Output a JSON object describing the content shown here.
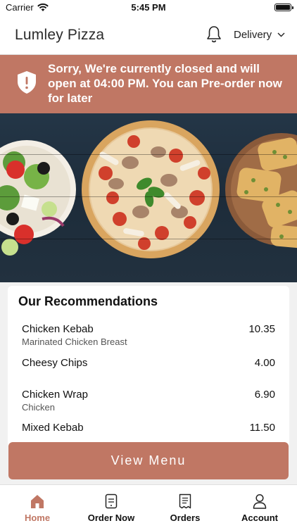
{
  "status_bar": {
    "carrier": "Carrier",
    "time": "5:45 PM"
  },
  "header": {
    "title": "Lumley Pizza",
    "mode_label": "Delivery"
  },
  "banner": {
    "message": "Sorry, We're currently closed and will open at 04:00 PM. You can Pre-order now for later"
  },
  "recommendations": {
    "heading": "Our Recommendations",
    "items": [
      {
        "name": "Chicken Kebab",
        "description": "Marinated Chicken Breast",
        "price": "10.35"
      },
      {
        "name": "Cheesy Chips",
        "description": "",
        "price": "4.00"
      },
      {
        "name": "Chicken Wrap",
        "description": "Chicken",
        "price": "6.90"
      },
      {
        "name": "Mixed Kebab",
        "description": "",
        "price": "11.50"
      }
    ]
  },
  "view_menu_label": "View Menu",
  "tabs": [
    {
      "label": "Home",
      "icon": "home-icon",
      "active": true
    },
    {
      "label": "Order Now",
      "icon": "order-icon",
      "active": false
    },
    {
      "label": "Orders",
      "icon": "receipt-icon",
      "active": false
    },
    {
      "label": "Account",
      "icon": "person-icon",
      "active": false
    }
  ],
  "colors": {
    "accent": "#c07764",
    "hero_bg": "#22313f"
  }
}
